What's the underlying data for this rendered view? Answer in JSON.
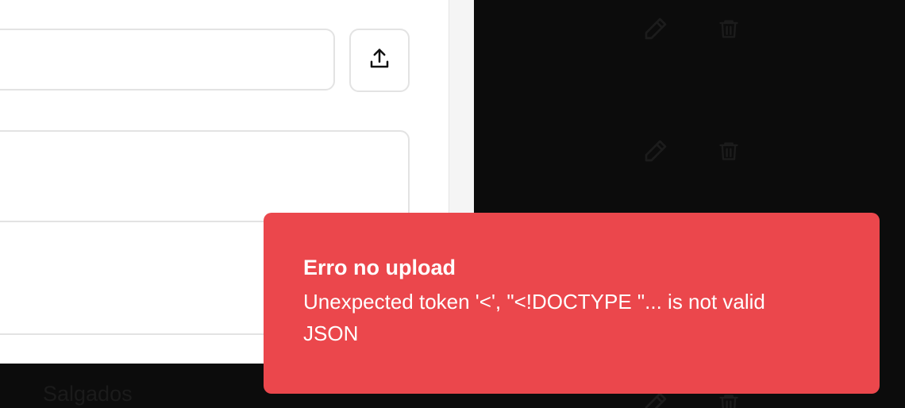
{
  "product_list": {
    "category_label": "Salgados",
    "row_actions": [
      {
        "edit_icon": "pencil-icon",
        "delete_icon": "trash-icon"
      },
      {
        "edit_icon": "pencil-icon",
        "delete_icon": "trash-icon"
      },
      {
        "edit_icon": "pencil-icon",
        "delete_icon": "trash-icon"
      }
    ]
  },
  "modal": {
    "image_url_value": "",
    "upload_icon": "upload-icon",
    "description_value": ""
  },
  "toast": {
    "title": "Erro no upload",
    "message": "Unexpected token '<', \"<!DOCTYPE \"... is not valid JSON",
    "background_color": "#eb474c"
  }
}
